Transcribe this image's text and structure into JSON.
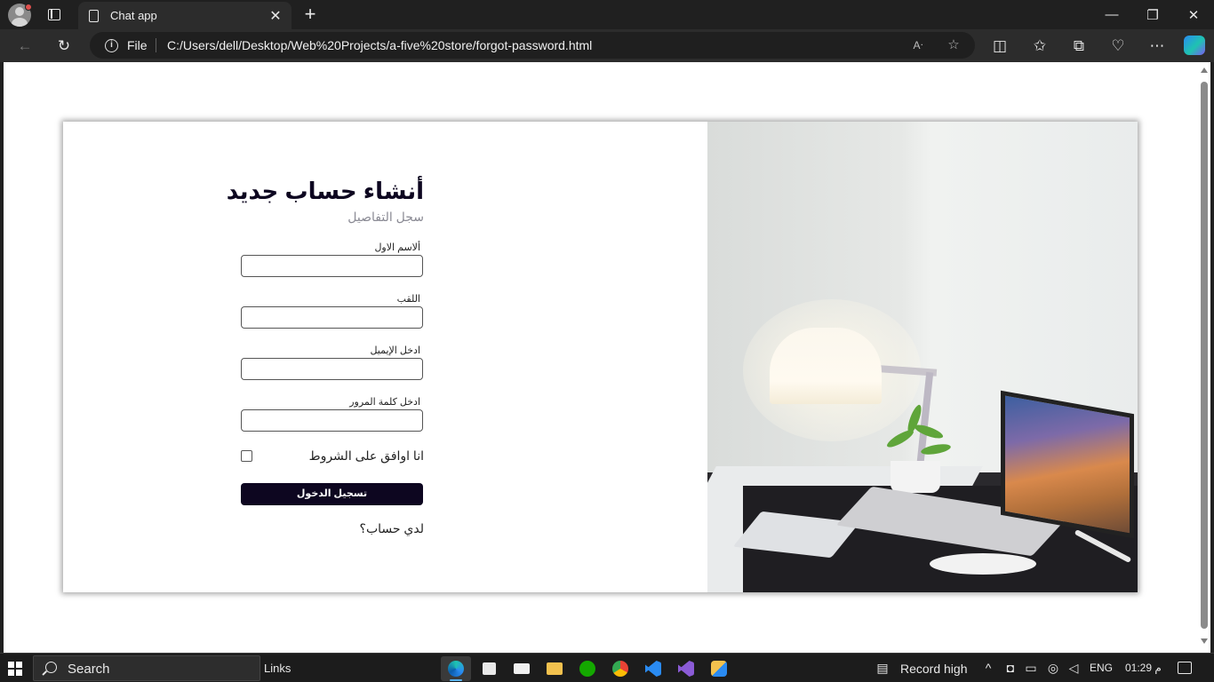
{
  "browser": {
    "tab_title": "Chat app",
    "new_tab": "+",
    "tab_close": "✕",
    "address": {
      "scheme_label": "File",
      "url": "C:/Users/dell/Desktop/Web%20Projects/a-five%20store/forgot-password.html"
    },
    "window_controls": {
      "minimize": "—",
      "maximize": "❐",
      "close": "✕"
    },
    "toolbar_icons": [
      "back-icon",
      "refresh-icon",
      "read-aloud-icon",
      "favorite-star-icon",
      "split-screen-icon",
      "favorites-icon",
      "collections-icon",
      "browser-essentials-icon",
      "more-icon",
      "copilot-icon"
    ]
  },
  "page": {
    "title": "أنشاء حساب جديد",
    "subtitle": "سجل التفاصيل",
    "fields": [
      {
        "label": "ألاسم الاول",
        "value": ""
      },
      {
        "label": "اللقب",
        "value": ""
      },
      {
        "label": "ادخل الإيميل",
        "value": ""
      },
      {
        "label": "ادخل كلمة المرور",
        "value": ""
      }
    ],
    "terms_label": "انا اوافق على الشروط",
    "terms_checked": false,
    "submit_label": "تسجيل الدخول",
    "have_account": "لدي حساب؟",
    "image_description_icon": "desk-laptop-lamp-photo"
  },
  "taskbar": {
    "search_placeholder": "Search",
    "links_label": "Links",
    "apps": [
      "edge-icon",
      "store-icon",
      "mail-icon",
      "file-explorer-icon",
      "upwork-icon",
      "chrome-icon",
      "vscode-icon",
      "visual-studio-icon",
      "sticky-app-icon"
    ],
    "tray": {
      "widget_label": "Record high",
      "language": "ENG",
      "time": "01:29 م"
    }
  },
  "colors": {
    "accent_dark": "#0d0620",
    "browser_bg": "#202020",
    "edge_blue": "#5cb4f5"
  }
}
